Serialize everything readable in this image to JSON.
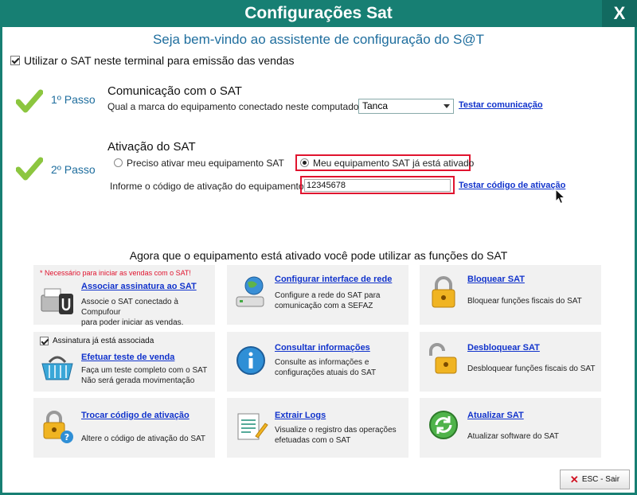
{
  "window": {
    "title": "Configurações Sat",
    "close_label": "X"
  },
  "welcome": "Seja bem-vindo ao assistente de configuração do S@T",
  "use_sat_label": "Utilizar o SAT neste terminal para emissão das vendas",
  "step1": {
    "label": "1º Passo",
    "title": "Comunicação com o SAT",
    "question": "Qual a marca do equipamento conectado neste computador?",
    "brand_value": "Tanca",
    "test_link": "Testar comunicação"
  },
  "step2": {
    "label": "2º Passo",
    "title": "Ativação do SAT",
    "radio_need": "Preciso ativar meu equipamento SAT",
    "radio_done": "Meu equipamento SAT já está ativado",
    "code_label": "Informe o código de ativação do equipamento:",
    "code_value": "12345678",
    "test_link": "Testar código de ativação"
  },
  "functions_label": "Agora que o equipamento está ativado você pode utilizar as funções do SAT",
  "cards": {
    "assinatura": {
      "note": "* Necessário para iniciar as vendas com o SAT!",
      "link": "Associar assinatura ao SAT",
      "desc1": "Associe o SAT conectado à Compufour",
      "desc2": "para poder iniciar as vendas."
    },
    "rede": {
      "link": "Configurar interface de rede",
      "desc1": "Configure a rede do SAT para",
      "desc2": "comunicação com a SEFAZ"
    },
    "bloquear": {
      "link": "Bloquear SAT",
      "desc1": "Bloquear funções fiscais do SAT"
    },
    "teste": {
      "checkbox": "Assinatura já está associada",
      "link": "Efetuar teste de venda",
      "desc1": "Faça um teste completo com o SAT",
      "desc2": "Não será gerada movimentação"
    },
    "consultar": {
      "link": "Consultar informações",
      "desc1": "Consulte as informações e",
      "desc2": "configurações atuais do SAT"
    },
    "desbloquear": {
      "link": "Desbloquear SAT",
      "desc1": "Desbloquear funções fiscais do SAT"
    },
    "trocar": {
      "link": "Trocar código de ativação",
      "desc1": "Altere o código de ativação do SAT"
    },
    "logs": {
      "link": "Extrair Logs",
      "desc1": "Visualize o registro das operações",
      "desc2": "efetuadas com o SAT"
    },
    "atualizar": {
      "link": "Atualizar SAT",
      "desc1": "Atualizar software do SAT"
    }
  },
  "esc_button": "ESC - Sair",
  "colors": {
    "titlebar": "#177f73",
    "accent_text": "#1f6e9e",
    "link": "#1133cc",
    "highlight_box": "#e0142f",
    "check_green": "#8cc63f"
  }
}
